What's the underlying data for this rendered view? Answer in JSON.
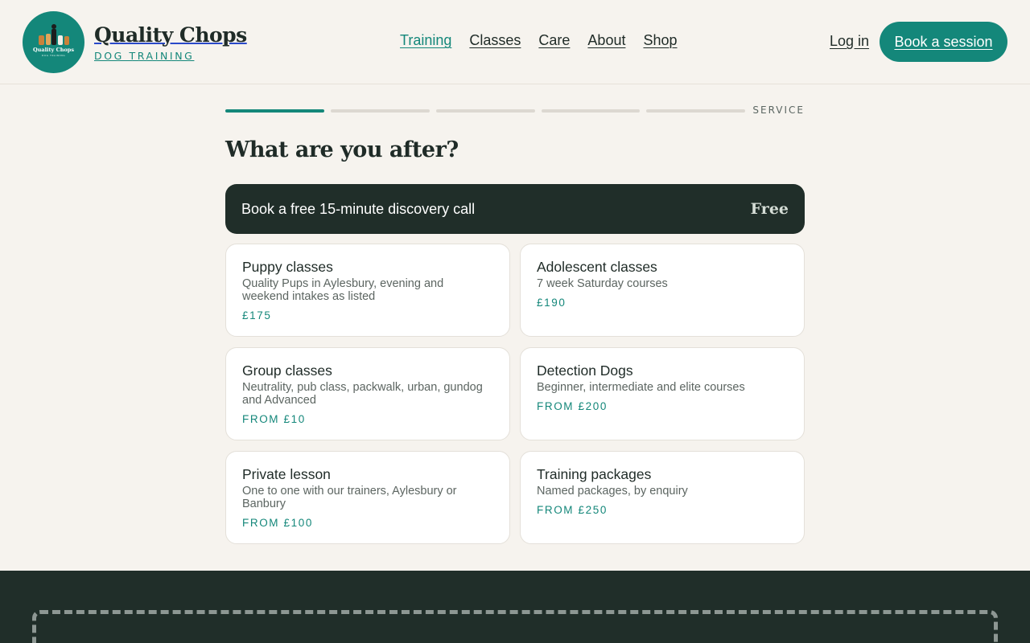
{
  "brand": {
    "name": "Quality Chops",
    "tagline": "DOG TRAINING",
    "logo_text": "Quality Chops",
    "logo_subtext": "DOG TRAINING"
  },
  "nav": {
    "items": [
      {
        "label": "Training",
        "active": true
      },
      {
        "label": "Classes",
        "active": false
      },
      {
        "label": "Care",
        "active": false
      },
      {
        "label": "About",
        "active": false
      },
      {
        "label": "Shop",
        "active": false
      }
    ],
    "login_label": "Log in",
    "cta_label": "Book a session"
  },
  "progress": {
    "total_steps": 5,
    "current_step": 1,
    "step_label": "SERVICE"
  },
  "heading": "What are you after?",
  "discovery": {
    "title": "Book a free 15-minute discovery call",
    "price": "Free"
  },
  "services": [
    {
      "title": "Puppy classes",
      "description": "Quality Pups in Aylesbury, evening and weekend intakes as listed",
      "price": "£175"
    },
    {
      "title": "Adolescent classes",
      "description": "7 week Saturday courses",
      "price": "£190"
    },
    {
      "title": "Group classes",
      "description": "Neutrality, pub class, packwalk, urban, gundog and Advanced",
      "price": "FROM £10"
    },
    {
      "title": "Detection Dogs",
      "description": "Beginner, intermediate and elite courses",
      "price": "FROM £200"
    },
    {
      "title": "Private lesson",
      "description": "One to one with our trainers, Aylesbury or Banbury",
      "price": "FROM £100"
    },
    {
      "title": "Training packages",
      "description": "Named packages, by enquiry",
      "price": "FROM £250"
    }
  ],
  "colors": {
    "accent": "#14877a",
    "dark": "#202e29",
    "background": "#f6f3ee"
  }
}
